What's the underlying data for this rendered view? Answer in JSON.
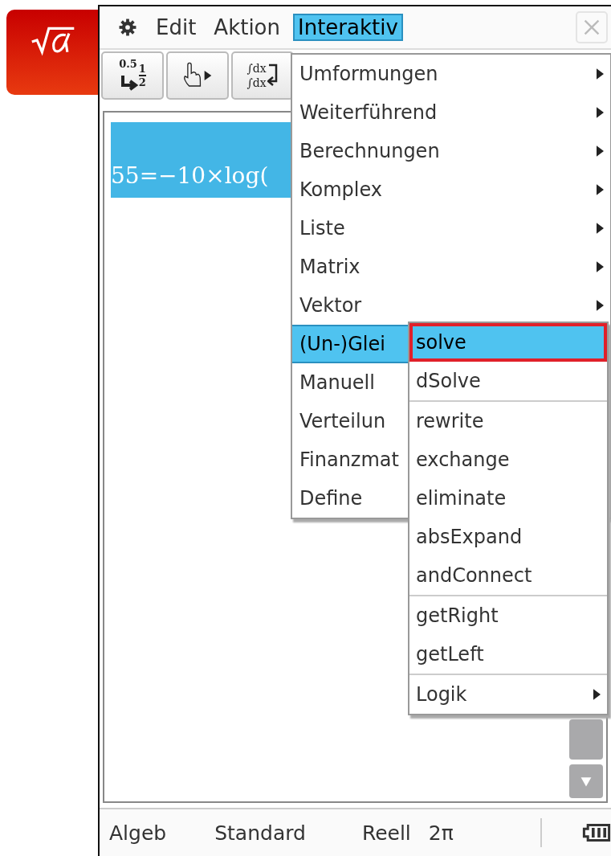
{
  "menu_bar": {
    "items": [
      {
        "label": "Edit",
        "selected": false
      },
      {
        "label": "Aktion",
        "selected": false
      },
      {
        "label": "Interaktiv",
        "selected": true
      }
    ]
  },
  "toolbar": {
    "buttons": [
      {
        "kind": "convert",
        "texts": [
          "0.5",
          "1",
          "2"
        ]
      },
      {
        "kind": "hand"
      },
      {
        "kind": "integral",
        "texts": [
          "∫dx",
          "∫dx"
        ]
      }
    ]
  },
  "work_area": {
    "expression": {
      "text": "55=−10×log(",
      "selected": true
    }
  },
  "menu": {
    "items": [
      {
        "label": "Umformungen",
        "submenu": true,
        "selected": false
      },
      {
        "label": "Weiterführend",
        "submenu": true,
        "selected": false
      },
      {
        "label": "Berechnungen",
        "submenu": true,
        "selected": false
      },
      {
        "label": "Komplex",
        "submenu": true,
        "selected": false
      },
      {
        "label": "Liste",
        "submenu": true,
        "selected": false
      },
      {
        "label": "Matrix",
        "submenu": true,
        "selected": false
      },
      {
        "label": "Vektor",
        "submenu": true,
        "selected": false
      },
      {
        "label": "(Un-)Glei",
        "submenu": false,
        "selected": true
      },
      {
        "label": "Manuell",
        "submenu": false,
        "selected": false
      },
      {
        "label": "Verteilun",
        "submenu": false,
        "selected": false
      },
      {
        "label": "Finanzmat",
        "submenu": false,
        "selected": false
      },
      {
        "label": "Define",
        "submenu": false,
        "selected": false
      }
    ]
  },
  "submenu": {
    "items": [
      {
        "label": "solve",
        "selected": true,
        "outlined": true,
        "separator_before": false,
        "submenu": false
      },
      {
        "label": "dSolve",
        "selected": false,
        "outlined": false,
        "separator_before": false,
        "submenu": false
      },
      {
        "label": "rewrite",
        "selected": false,
        "outlined": false,
        "separator_before": true,
        "submenu": false
      },
      {
        "label": "exchange",
        "selected": false,
        "outlined": false,
        "separator_before": false,
        "submenu": false
      },
      {
        "label": "eliminate",
        "selected": false,
        "outlined": false,
        "separator_before": false,
        "submenu": false
      },
      {
        "label": "absExpand",
        "selected": false,
        "outlined": false,
        "separator_before": false,
        "submenu": false
      },
      {
        "label": "andConnect",
        "selected": false,
        "outlined": false,
        "separator_before": false,
        "submenu": false
      },
      {
        "label": "getRight",
        "selected": false,
        "outlined": false,
        "separator_before": true,
        "submenu": false
      },
      {
        "label": "getLeft",
        "selected": false,
        "outlined": false,
        "separator_before": false,
        "submenu": false
      },
      {
        "label": "Logik",
        "selected": false,
        "outlined": false,
        "separator_before": true,
        "submenu": true
      }
    ]
  },
  "status_bar": {
    "items": [
      "Algeb",
      "Standard",
      "Reell",
      "2π"
    ]
  }
}
